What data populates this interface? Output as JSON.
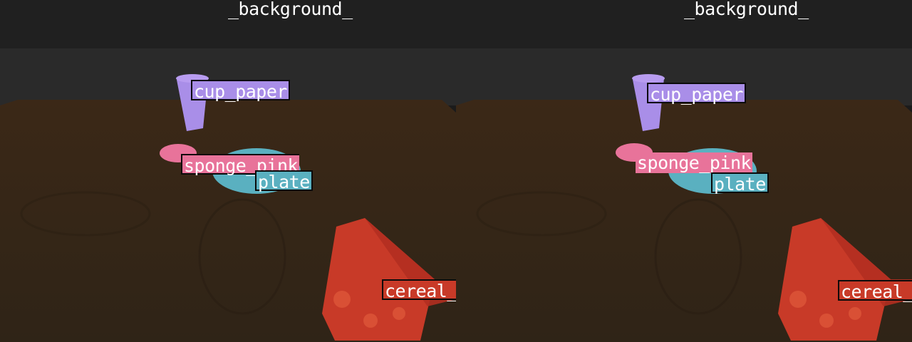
{
  "panels": [
    {
      "id": "left",
      "labels": {
        "background": "_background_",
        "cup": "cup_paper",
        "sponge": "sponge_pink",
        "plate": "plate",
        "cereal": "cereal_"
      }
    },
    {
      "id": "right",
      "labels": {
        "background": "_background_",
        "cup": "cup_paper",
        "sponge": "sponge_pink",
        "plate": "plate",
        "cereal": "cereal_"
      }
    }
  ],
  "colors": {
    "wall_top": "#202020",
    "wall_mid": "#2a2a2a",
    "table": "#3a2818",
    "cup": "#a98ee8",
    "sponge": "#e8739a",
    "plate": "#5ab0c0",
    "cereal": "#c83a28"
  }
}
